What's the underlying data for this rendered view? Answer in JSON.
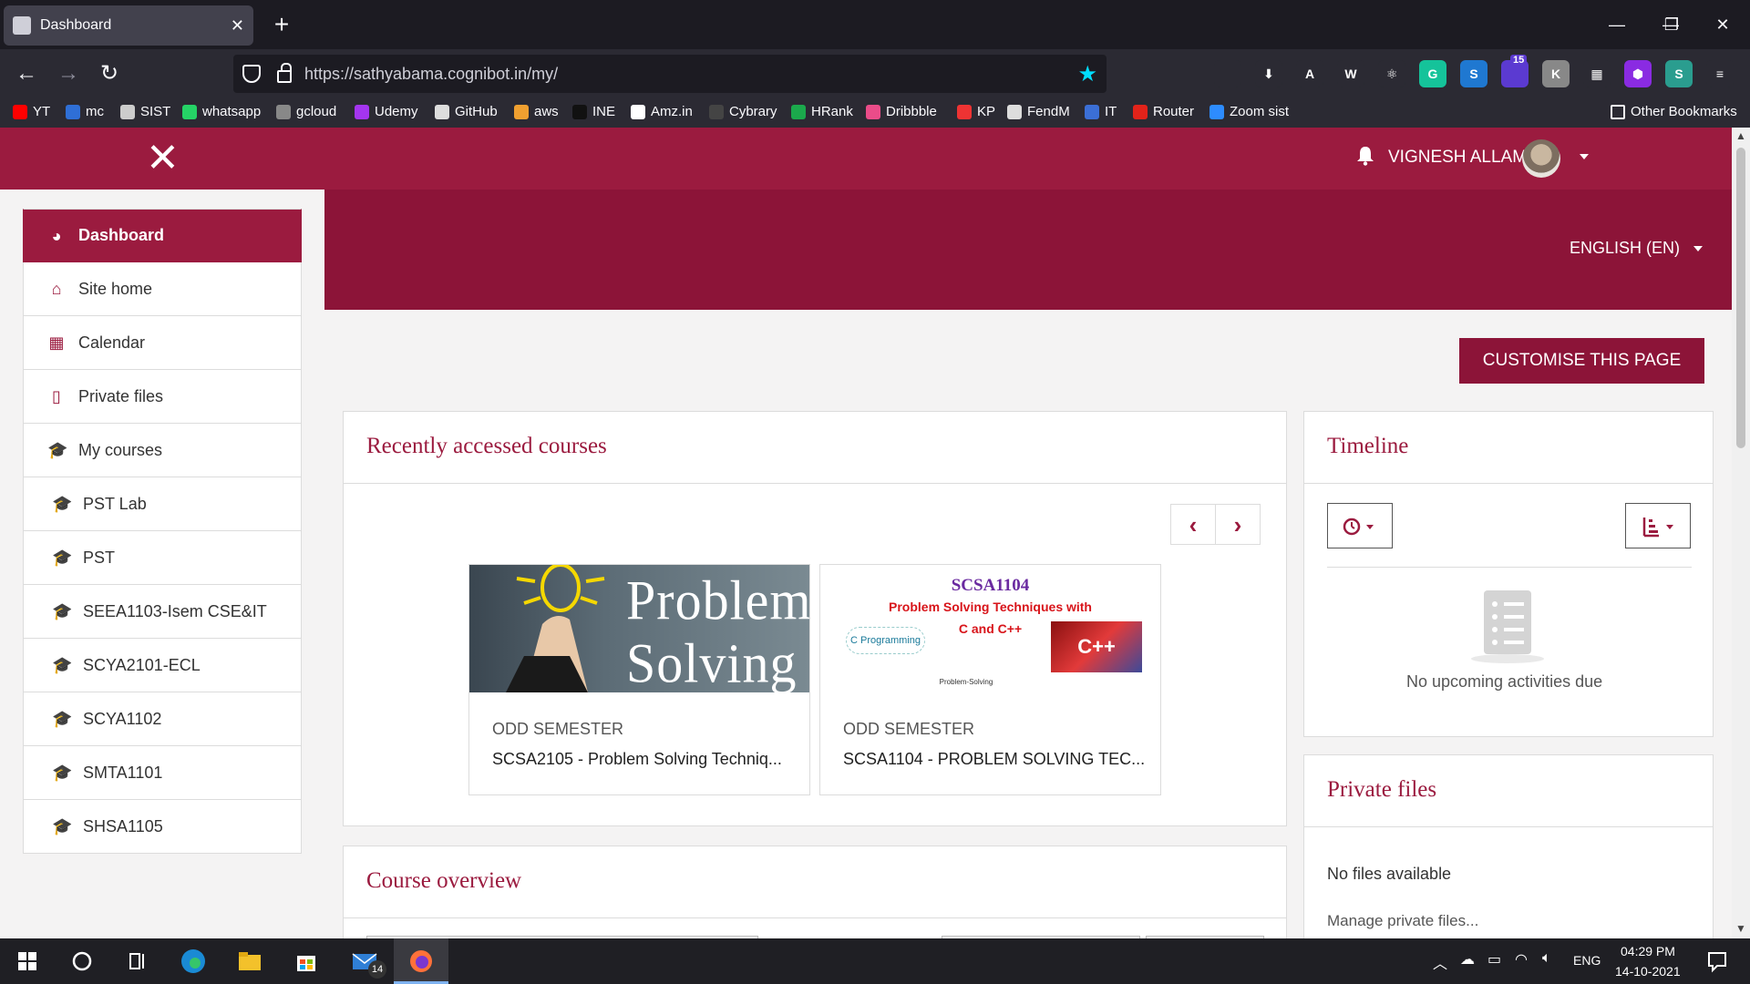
{
  "browser": {
    "tab_title": "Dashboard",
    "tab_close": "✕",
    "new_tab": "+",
    "url": "https://sathyabama.cognibot.in/my/",
    "window_controls": [
      "—",
      "❐",
      "✕"
    ],
    "extension_badge": "15",
    "extensions": [
      {
        "icon": "pocket-icon",
        "label": "",
        "color": "#2b2a33"
      },
      {
        "icon": "download-icon",
        "label": "⬇",
        "color": "#2b2a33"
      },
      {
        "icon": "a-extension-icon",
        "label": "A",
        "color": "#2b2a33"
      },
      {
        "icon": "w-extension-icon",
        "label": "W",
        "color": "#2b2a33"
      },
      {
        "icon": "react-devtools-icon",
        "label": "⚛",
        "color": "#2b2a33"
      },
      {
        "icon": "grammarly-icon",
        "label": "G",
        "color": "#15c39a"
      },
      {
        "icon": "s-extension-icon",
        "label": "S",
        "color": "#1f78d1"
      },
      {
        "icon": "twitch-extension-icon",
        "label": "",
        "color": "#5b3ad1"
      },
      {
        "icon": "k-extension-icon",
        "label": "K",
        "color": "#888"
      },
      {
        "icon": "grid-extension-icon",
        "label": "▦",
        "color": "#2b2a33"
      },
      {
        "icon": "hexagon-extension-icon",
        "label": "⬢",
        "color": "#8a2be2"
      },
      {
        "icon": "s2-extension-icon",
        "label": "S",
        "color": "#2a9d8f"
      },
      {
        "icon": "menu-icon",
        "label": "≡",
        "color": "#2b2a33"
      }
    ],
    "bookmarks": [
      {
        "label": "YT",
        "color": "#ff0000",
        "icon": "youtube-icon"
      },
      {
        "label": "mc",
        "color": "#2f6fd6",
        "icon": "mc-icon"
      },
      {
        "label": "SIST",
        "color": "#cccccc",
        "icon": "sist-icon"
      },
      {
        "label": "whatsapp",
        "color": "#25d366",
        "icon": "whatsapp-icon"
      },
      {
        "label": "gcloud",
        "color": "#888888",
        "icon": "gcloud-icon"
      },
      {
        "label": "Udemy",
        "color": "#a435f0",
        "icon": "udemy-icon"
      },
      {
        "label": "GitHub",
        "color": "#dddddd",
        "icon": "github-icon"
      },
      {
        "label": "aws",
        "color": "#f0a030",
        "icon": "aws-icon"
      },
      {
        "label": "INE",
        "color": "#111111",
        "icon": "ine-icon"
      },
      {
        "label": "Amz.in",
        "color": "#ffffff",
        "icon": "amazon-icon"
      },
      {
        "label": "Cybrary",
        "color": "#444444",
        "icon": "cybrary-icon"
      },
      {
        "label": "HRank",
        "color": "#1ba94c",
        "icon": "hackerrank-icon"
      },
      {
        "label": "Dribbble",
        "color": "#ea4c89",
        "icon": "dribbble-icon"
      },
      {
        "label": "KP",
        "color": "#e33",
        "icon": "kp-icon"
      },
      {
        "label": "FendM",
        "color": "#dddddd",
        "icon": "fendm-icon"
      },
      {
        "label": "IT",
        "color": "#3b6fd6",
        "icon": "it-icon"
      },
      {
        "label": "Router",
        "color": "#e2231a",
        "icon": "jio-icon"
      },
      {
        "label": "Zoom sist",
        "color": "#2d8cff",
        "icon": "zoom-icon"
      }
    ],
    "other_bookmarks": "Other Bookmarks"
  },
  "topnav": {
    "close_icon": "✕",
    "username": "VIGNESH ALLAM",
    "language": "ENGLISH (EN)"
  },
  "sidebar": {
    "items": [
      {
        "label": "Dashboard",
        "icon": "dashboard-icon",
        "glyph": "◕"
      },
      {
        "label": "Site home",
        "icon": "home-icon",
        "glyph": "⌂"
      },
      {
        "label": "Calendar",
        "icon": "calendar-icon",
        "glyph": "▦"
      },
      {
        "label": "Private files",
        "icon": "file-icon",
        "glyph": "▯"
      },
      {
        "label": "My courses",
        "icon": "graduation-cap-icon",
        "glyph": "🎓"
      },
      {
        "label": "PST Lab",
        "icon": "graduation-cap-icon",
        "glyph": "🎓"
      },
      {
        "label": "PST",
        "icon": "graduation-cap-icon",
        "glyph": "🎓"
      },
      {
        "label": "SEEA1103-Isem CSE&IT",
        "icon": "graduation-cap-icon",
        "glyph": "🎓"
      },
      {
        "label": "SCYA2101-ECL",
        "icon": "graduation-cap-icon",
        "glyph": "🎓"
      },
      {
        "label": "SCYA1102",
        "icon": "graduation-cap-icon",
        "glyph": "🎓"
      },
      {
        "label": "SMTA1101",
        "icon": "graduation-cap-icon",
        "glyph": "🎓"
      },
      {
        "label": "SHSA1105",
        "icon": "graduation-cap-icon",
        "glyph": "🎓"
      }
    ]
  },
  "main": {
    "customise_button": "CUSTOMISE THIS PAGE",
    "recent": {
      "title": "Recently accessed courses",
      "prev": "‹",
      "next": "›",
      "courses": [
        {
          "category": "ODD SEMESTER",
          "name": "SCSA2105 - Problem Solving Techniq...",
          "image_text": "Problem Solving"
        },
        {
          "category": "ODD SEMESTER",
          "name": "SCSA1104 - PROBLEM SOLVING TEC...",
          "image_title": "SCSA1104",
          "image_subtitle": "Problem Solving Techniques with",
          "image_subtitle2": "C and C++",
          "image_footer": "Problem-Solving",
          "image_word": "C Programming",
          "image_badge": "C++"
        }
      ]
    },
    "overview": {
      "title": "Course overview"
    }
  },
  "timeline": {
    "title": "Timeline",
    "empty": "No upcoming activities due"
  },
  "private_files": {
    "title": "Private files",
    "empty": "No files available",
    "manage": "Manage private files..."
  },
  "taskbar": {
    "mail_badge": "14",
    "lang": "ENG",
    "time": "04:29 PM",
    "date": "14-10-2021"
  },
  "colors": {
    "brand": "#9b1b3f",
    "banner": "#8c1438"
  }
}
